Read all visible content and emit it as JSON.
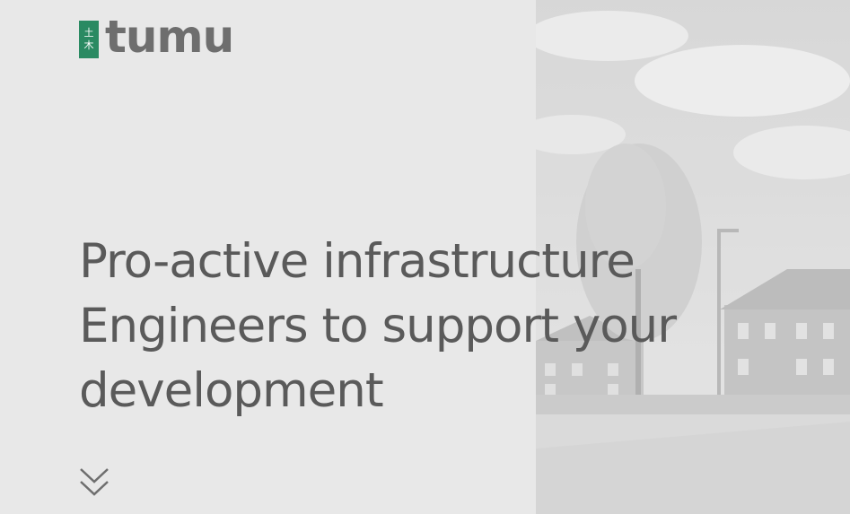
{
  "brand": {
    "logo_mark_top": "土",
    "logo_mark_bottom": "木",
    "wordmark": "tumu",
    "accent_color": "#2a8a62",
    "text_color": "#6e6e6e"
  },
  "hero": {
    "headline_line1": "Pro-active infrastructure",
    "headline_line2": "Engineers to support your",
    "headline_line3": "development",
    "scroll_icon": "double-chevron-down-icon",
    "background_color": "#e8e8e8"
  }
}
